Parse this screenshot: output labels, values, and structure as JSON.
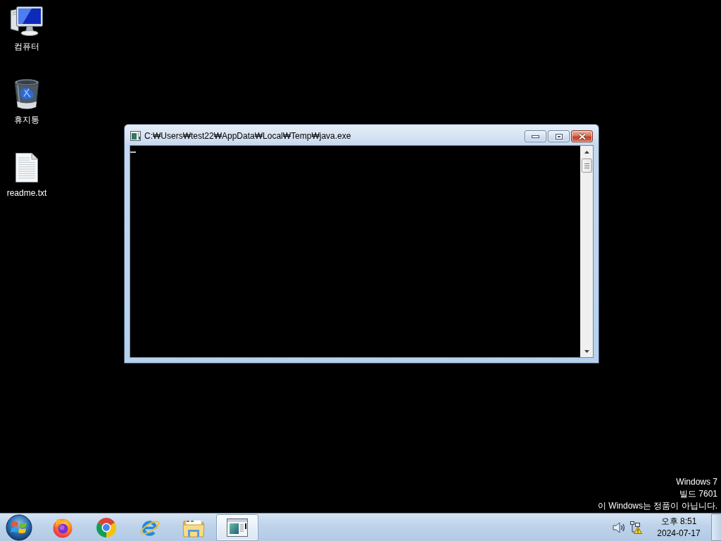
{
  "desktop": {
    "icons": [
      {
        "kind": "computer",
        "label": "컴퓨터"
      },
      {
        "kind": "trash",
        "label": "휴지통"
      },
      {
        "kind": "document",
        "label": "readme.txt"
      }
    ],
    "notice": [
      "Windows 7",
      "빌드 7601",
      "이 Windows는 정품이 아닙니다."
    ]
  },
  "window": {
    "title": "C:₩Users₩test22₩AppData₩Local₩Temp₩java.exe"
  },
  "taskbar": {
    "buttons": [
      {
        "kind": "fox",
        "selected": false
      },
      {
        "kind": "tricolor",
        "selected": false
      },
      {
        "kind": "e-logo",
        "selected": false
      },
      {
        "kind": "folder",
        "selected": false
      },
      {
        "kind": "console",
        "selected": true
      }
    ],
    "clock": {
      "time": "오후 8:51",
      "date": "2024-07-17"
    }
  }
}
